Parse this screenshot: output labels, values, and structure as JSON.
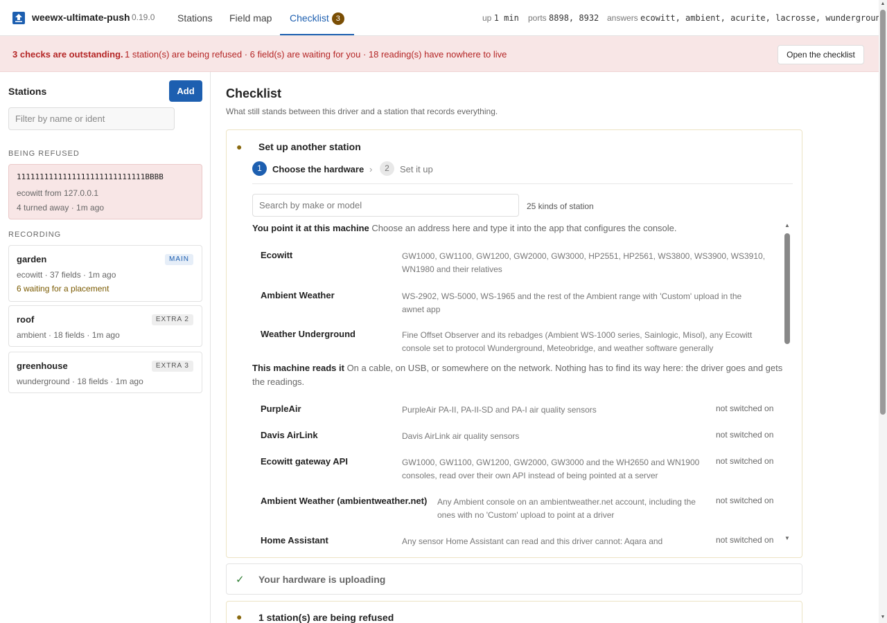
{
  "app": {
    "name": "weewx-ultimate-push",
    "version": "0.19.0"
  },
  "tabs": [
    {
      "label": "Stations"
    },
    {
      "label": "Field map"
    },
    {
      "label": "Checklist",
      "badge": "3"
    }
  ],
  "topbar": {
    "up_label": "up",
    "up_value": "1 min",
    "ports_label": "ports",
    "ports_value": "8898, 8932",
    "answers_label": "answers",
    "answers_value": "ecowitt, ambient, acurite, lacrosse, wunderground"
  },
  "alert": {
    "strong": "3 checks are outstanding.",
    "detail": "1 station(s) are being refused · 6 field(s) are waiting for you · 18 reading(s) have nowhere to live",
    "button": "Open the checklist"
  },
  "sidebar": {
    "title": "Stations",
    "add_label": "Add",
    "filter_placeholder": "Filter by name or ident",
    "refused_label": "BEING REFUSED",
    "refused": {
      "ident": "1111111111111111111111111111BBBB",
      "source": "ecowitt from 127.0.0.1",
      "status": "4 turned away · 1m ago"
    },
    "recording_label": "RECORDING",
    "stations": [
      {
        "name": "garden",
        "badge": "MAIN",
        "meta": "ecowitt · 37 fields · 1m ago",
        "warning": "6 waiting for a placement"
      },
      {
        "name": "roof",
        "badge": "EXTRA 2",
        "meta": "ambient · 18 fields · 1m ago"
      },
      {
        "name": "greenhouse",
        "badge": "EXTRA 3",
        "meta": "wunderground · 18 fields · 1m ago"
      }
    ]
  },
  "main": {
    "title": "Checklist",
    "subtitle": "What still stands between this driver and a station that records everything.",
    "setup": {
      "bullet": "●",
      "title": "Set up another station",
      "step1_num": "1",
      "step1_label": "Choose the hardware",
      "step_sep": "›",
      "step2_num": "2",
      "step2_label": "Set it up",
      "search_placeholder": "Search by make or model",
      "count": "25 kinds of station",
      "push_group": {
        "title": "You point it at this machine",
        "text": "Choose an address here and type it into the app that configures the console."
      },
      "push_items": [
        {
          "name": "Ecowitt",
          "desc": "GW1000, GW1100, GW1200, GW2000, GW3000, HP2551, HP2561, WS3800, WS3900, WS3910, WN1980 and their relatives"
        },
        {
          "name": "Ambient Weather",
          "desc": "WS-2902, WS-5000, WS-1965 and the rest of the Ambient range with 'Custom' upload in the awnet app"
        },
        {
          "name": "Weather Underground",
          "desc": "Fine Offset Observer and its rebadges (Ambient WS-1000 series, Sainlogic, Misol), any Ecowitt console set to protocol Wunderground, Meteobridge, and weather software generally"
        }
      ],
      "pull_group": {
        "title": "This machine reads it",
        "text": "On a cable, on USB, or somewhere on the network. Nothing has to find its way here: the driver goes and gets the readings."
      },
      "pull_items": [
        {
          "name": "PurpleAir",
          "desc": "PurpleAir PA-II, PA-II-SD and PA-I air quality sensors",
          "status": "not switched on"
        },
        {
          "name": "Davis AirLink",
          "desc": "Davis AirLink air quality sensors",
          "status": "not switched on"
        },
        {
          "name": "Ecowitt gateway API",
          "desc": "GW1000, GW1100, GW1200, GW2000, GW3000 and the WH2650 and WN1900 consoles, read over their own API instead of being pointed at a server",
          "status": "not switched on"
        },
        {
          "name": "Ambient Weather (ambientweather.net)",
          "desc": "Any Ambient console on an ambientweather.net account, including the ones with no 'Custom' upload to point at a driver",
          "status": "not switched on"
        },
        {
          "name": "Home Assistant",
          "desc": "Any sensor Home Assistant can read and this driver cannot: Aqara and",
          "status": "not switched on"
        }
      ]
    },
    "uploading": {
      "check": "✓",
      "title": "Your hardware is uploading"
    },
    "refused_panel": {
      "bullet": "●",
      "title": "1 station(s) are being refused"
    }
  }
}
